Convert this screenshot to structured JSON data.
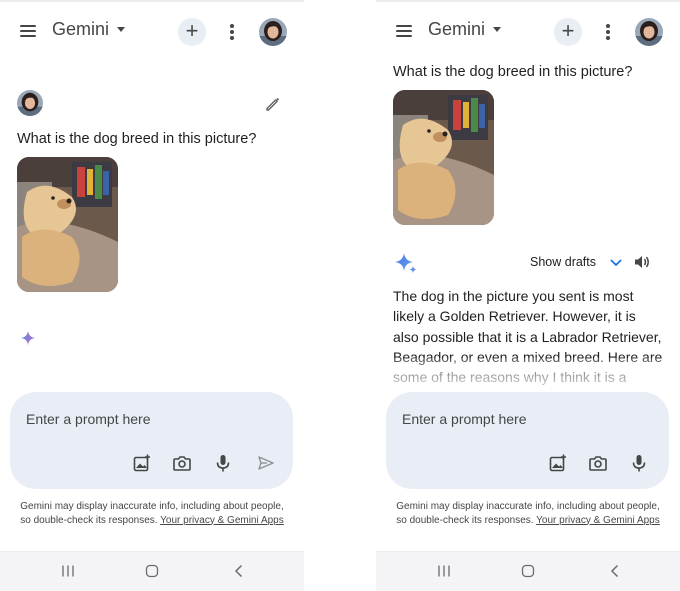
{
  "screens": [
    {
      "app_title": "Gemini",
      "question": "What is the dog breed in this picture?",
      "composer_placeholder": "Enter a prompt here",
      "disclaimer_text": "Gemini may display inaccurate info, including about people, so double-check its responses.",
      "disclaimer_link": "Your privacy & Gemini Apps"
    },
    {
      "app_title": "Gemini",
      "question": "What is the dog breed in this picture?",
      "show_drafts_label": "Show drafts",
      "answer_text": "The dog in the picture you sent is most likely a Golden Retriever. However, it is also possible that it is a Labrador Retriever, Beagador, or even a mixed breed. Here are some of the reasons why I think it is a",
      "composer_placeholder": "Enter a prompt here",
      "disclaimer_text": "Gemini may display inaccurate info, including about people, so double-check its responses.",
      "disclaimer_link": "Your privacy & Gemini Apps"
    }
  ],
  "icons": {
    "menu": "menu-icon",
    "title_dropdown": "caret-down-icon",
    "new_chat": "plus-icon",
    "more": "more-vert-icon",
    "edit": "pencil-icon",
    "gemini": "gemini-spark-icon",
    "drafts_toggle": "chevron-down-icon",
    "read_aloud": "speaker-icon",
    "add_image": "add-image-icon",
    "camera": "camera-icon",
    "microphone": "mic-icon",
    "send": "send-icon",
    "nav_recents": "recents-icon",
    "nav_home": "home-icon",
    "nav_back": "back-icon"
  },
  "colors": {
    "composer_bg": "#e9eef6",
    "accent_blue": "#1a73e8",
    "icon_gray": "#444746",
    "navbar_bg": "#f4f4f6"
  }
}
